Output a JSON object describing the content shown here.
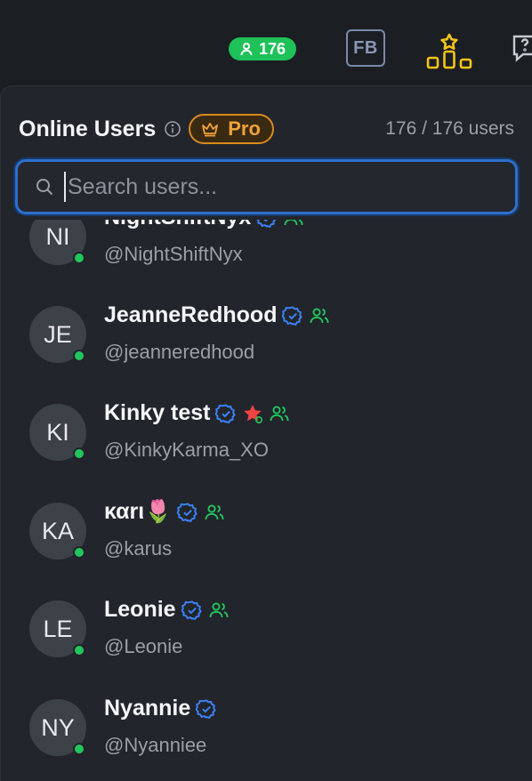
{
  "topbar": {
    "online_count": "176",
    "fb_label": "FB"
  },
  "panel": {
    "title": "Online Users",
    "pro_label": "Pro",
    "count_text": "176 / 176 users",
    "search_placeholder": "Search users..."
  },
  "users": [
    {
      "initials": "NI",
      "name": "NightShiftNyx",
      "handle": "@NightShiftNyx",
      "verified": true,
      "friends": true
    },
    {
      "initials": "JE",
      "name": "JeanneRedhood",
      "handle": "@jeanneredhood",
      "verified": true,
      "friends": true
    },
    {
      "initials": "KI",
      "name": "Kinky test",
      "handle": "@KinkyKarma_XO",
      "verified": true,
      "star": true,
      "friends": true
    },
    {
      "initials": "KA",
      "name": "καrι🌷",
      "handle": "@karus",
      "verified": true,
      "friends": true
    },
    {
      "initials": "LE",
      "name": "Leonie",
      "handle": "@Leonie",
      "verified": true,
      "friends": true
    },
    {
      "initials": "NY",
      "name": "Nyannie",
      "handle": "@Nyanniee",
      "verified": true,
      "friends": false
    }
  ],
  "colors": {
    "online_green": "#1fc159",
    "verified_blue": "#3b82f6",
    "friends_green": "#22c55e",
    "pro_orange": "#f0a23a",
    "accent_yellow": "#f5c518",
    "star_red": "#ef4444"
  },
  "icons": {
    "online": "user-icon",
    "fb": "fb-icon",
    "leaderboard": "leaderboard-icon",
    "help": "help-chat-icon",
    "info": "info-icon",
    "pro": "crown-icon",
    "search": "search-icon",
    "verified": "verified-badge-icon",
    "friends": "friends-icon",
    "star": "star-icon"
  }
}
